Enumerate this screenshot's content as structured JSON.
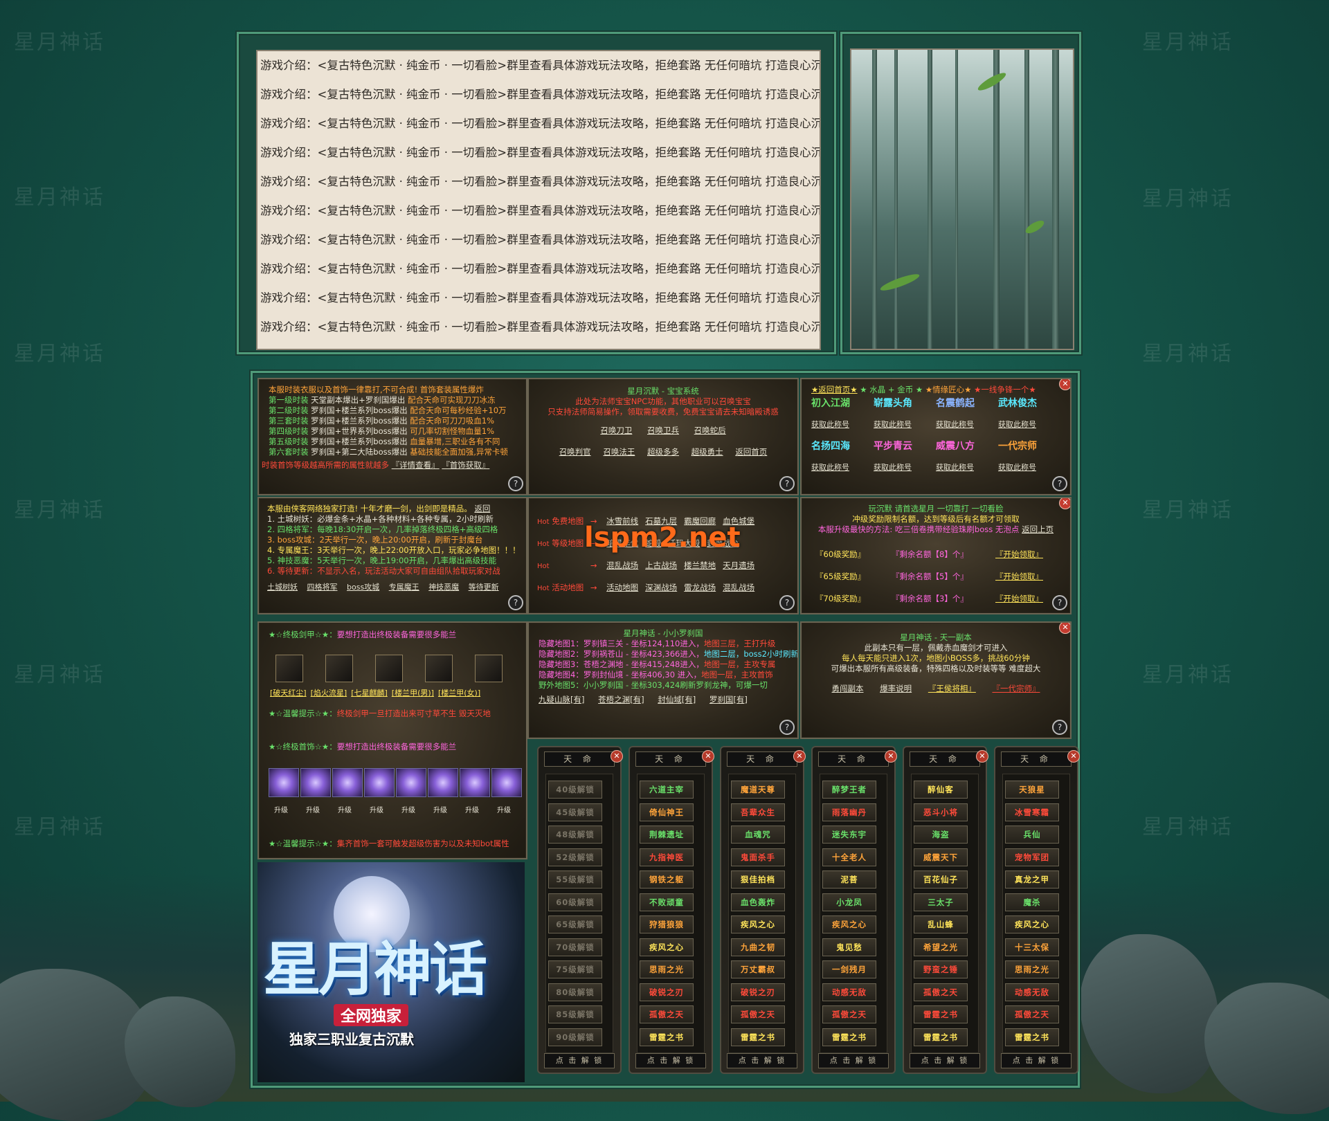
{
  "watermark": "星月神话",
  "intro_lines": [
    "游戏介绍：<复古特色沉默 · 纯金币 · 一切看脸>群里查看具体游戏玩法攻略，拒绝套路 无任何暗坑 打造良心沉默",
    "游戏介绍：<复古特色沉默 · 纯金币 · 一切看脸>群里查看具体游戏玩法攻略，拒绝套路 无任何暗坑 打造良心沉默",
    "游戏介绍：<复古特色沉默 · 纯金币 · 一切看脸>群里查看具体游戏玩法攻略，拒绝套路 无任何暗坑 打造良心沉默",
    "游戏介绍：<复古特色沉默 · 纯金币 · 一切看脸>群里查看具体游戏玩法攻略，拒绝套路 无任何暗坑 打造良心沉默",
    "游戏介绍：<复古特色沉默 · 纯金币 · 一切看脸>群里查看具体游戏玩法攻略，拒绝套路 无任何暗坑 打造良心沉默",
    "游戏介绍：<复古特色沉默 · 纯金币 · 一切看脸>群里查看具体游戏玩法攻略，拒绝套路 无任何暗坑 打造良心沉默",
    "游戏介绍：<复古特色沉默 · 纯金币 · 一切看脸>群里查看具体游戏玩法攻略，拒绝套路 无任何暗坑 打造良心沉默",
    "游戏介绍：<复古特色沉默 · 纯金币 · 一切看脸>群里查看具体游戏玩法攻略，拒绝套路 无任何暗坑 打造良心沉默",
    "游戏介绍：<复古特色沉默 · 纯金币 · 一切看脸>群里查看具体游戏玩法攻略，拒绝套路 无任何暗坑 打造良心沉默",
    "游戏介绍：<复古特色沉默 · 纯金币 · 一切看脸>群里查看具体游戏玩法攻略，拒绝套路 无任何暗坑 打造良心沉默"
  ],
  "p1": {
    "title": "本服时装衣服以及首饰一律靠打,不可合成! 首饰套装属性爆炸",
    "rows": [
      {
        "a": "第一级时装",
        "b": "天堂副本爆出+罗刹国爆出",
        "c": "配合天命可实现刀刀冰冻"
      },
      {
        "a": "第二级时装",
        "b": "罗刹国+楼兰系列boss爆出",
        "c": "配合天命可每秒经验+10万"
      },
      {
        "a": "第三套时装",
        "b": "罗刹国+楼兰系列boss爆出",
        "c": "配合天命可刀刀吸血1%"
      },
      {
        "a": "第四级时装",
        "b": "罗刹国+世界系列boss爆出",
        "c": "可几率切割怪物血量1%"
      },
      {
        "a": "第五级时装",
        "b": "罗刹国+楼兰系列boss爆出",
        "c": "血量暴增,三职业各有不同"
      },
      {
        "a": "第六套时装",
        "b": "罗刹国+第二大陆boss爆出",
        "c": "基础技能全面加强,异常卡顿"
      }
    ],
    "footer": "时装首饰等级越高所需的属性就越多",
    "link1": "『详情查看』",
    "link2": "『首饰获取』"
  },
  "p2": {
    "title": "星月沉默 - 宝宝系统",
    "line1": "此处为法师宝宝NPC功能，其他职业可以召唤宝宝",
    "line2": "只支持法师简易操作，领取需要收费，免费宝宝请去未知暗殿诱惑",
    "links_row1": [
      "召唤刀卫",
      "召唤卫兵",
      "召唤蛇后"
    ],
    "links_row2": [
      "召唤判官",
      "召唤法王",
      "超级多多",
      "超级勇士",
      "返回首页"
    ]
  },
  "p3": {
    "header": [
      "★返回首页★",
      "★ 水晶 + 金币 ★",
      "★情缘匠心★",
      "★一线争锋一个★"
    ],
    "titles1": [
      "初入江湖",
      "崭露头角",
      "名震鹤起",
      "武林俊杰"
    ],
    "titles2": [
      "名扬四海",
      "平步青云",
      "威震八方",
      "一代宗师"
    ],
    "claim": "获取此称号"
  },
  "p4": {
    "title": "本服由侠客网络独家打造! 十年才磨一剑，出剑即是精品。",
    "back": "返回",
    "lines": [
      "1. 土城树妖：必爆金条+水晶+各种材料+各种专属，2小时刷新",
      "2. 四格将军：每晚18:30开启一次，几率掉落终极四格+高级四格",
      "3. boss攻城：2天举行一次，晚上20:00开启，刷新于封魔台",
      "4. 专属魔王：3天举行一次，晚上22:00开放入口，玩家必争地图！！！",
      "5. 神技恶魔：5天举行一次，晚上19:00开启，几率爆出高级技能",
      "6. 等待更新：不显示入名，玩法活动大家可自由组队拾取玩家对战"
    ],
    "links": [
      "土城树妖",
      "四格将军",
      "boss攻城",
      "专属魔王",
      "神技恶魔",
      "等待更新"
    ]
  },
  "p5": {
    "rows": [
      {
        "tag": "Hot",
        "name": "免费地图",
        "items": [
          "冰雪前线",
          "石墓九层",
          "霸魔回廊",
          "血色城堡"
        ]
      },
      {
        "tag": "Hot",
        "name": "等级地图",
        "items": [
          "暗黑年代",
          "蛇殿",
          "沃玛大殿",
          "封魔战台"
        ]
      },
      {
        "tag": "Hot",
        "name": "",
        "items": [
          "混乱战场",
          "上古战场",
          "楼兰禁地",
          "天月遗场"
        ]
      },
      {
        "tag": "Hot",
        "name": "活动地图",
        "items": [
          "活动地图",
          "深渊战场",
          "雷龙战场",
          "混乱战场"
        ]
      }
    ],
    "arrow": "→",
    "watermark": "lspm2.net"
  },
  "p6": {
    "title": "玩沉默 请首选星月 一切靠打 一切看脸",
    "line1": "冲级奖励限制名额，达到等级后有名额才可领取",
    "line2": "本服升级最快的方法: 吃三倍卷携带经验珠刷boss 无泡点",
    "back": "返回上页",
    "rows": [
      {
        "a": "『60级奖励』",
        "b": "『剩余名额【8】个』",
        "c": "『开始领取』"
      },
      {
        "a": "『65级奖励』",
        "b": "『剩余名额【5】个』",
        "c": "『开始领取』"
      },
      {
        "a": "『70级奖励』",
        "b": "『剩余名额【3】个』",
        "c": "『开始领取』"
      }
    ]
  },
  "p7": {
    "title1": "★☆终极剑甲☆★：",
    "hint1": "要想打造出终极装备需要很多能兰",
    "equips": [
      "[破天红尘]",
      "[焰火流星]",
      "[七星麒麟]",
      "[楼兰甲(男)]",
      "[楼兰甲(女)]"
    ],
    "tip1_label": "★☆温馨提示☆★：",
    "tip1": "终极剑甲一旦打造出来可寸草不生 毁天灭地",
    "title2": "★☆终极首饰☆★：",
    "hint2": "要想打造出终极装备需要很多能兰",
    "upgrade": "升级",
    "tip2_label": "★☆温馨提示☆★：",
    "tip2": "集齐首饰一套可触发超级伤害为以及未知bot属性"
  },
  "p8": {
    "title": "星月神话 - 小小罗刹国",
    "rows": [
      {
        "a": "隐藏地图1：罗刹镇三关 - 坐标124,110进入，",
        "b": "地图三层，王打升级"
      },
      {
        "a": "隐藏地图2：罗刹祸苍山 - 坐标423,366进入，",
        "b": "地图二层，boss2小时刷新"
      },
      {
        "a": "隐藏地图3：苍梧之渊地 - 坐标415,248进入，",
        "b": "地图一层，主攻专属"
      },
      {
        "a": "隐藏地图4：罗刹封仙境 - 坐标406,30 进入，",
        "b": "地图一层，主攻首饰"
      },
      {
        "a": "野外地图5：小小罗刹国 - 坐标303,424刷新",
        "b": "罗刹龙神，可爆一切"
      }
    ],
    "links": [
      "九疑山脉[有]",
      "苍梧之渊[有]",
      "封仙域[有]",
      "罗刹国[有]"
    ]
  },
  "p9": {
    "title": "星月神话 - 天一副本",
    "line1": "此副本只有一层，佩戴赤血魔剑才可进入",
    "line2": "每人每天能只进入1次，地图小BOSS多，挑战60分钟",
    "line3": "可爆出本服所有高级装备，特殊四格以及时装等等 难度超大",
    "links": [
      "勇闯副本",
      "爆率说明",
      "『王侯将相』",
      "『一代宗师』"
    ]
  },
  "logo": {
    "main": "星月神话",
    "sub1": "全网独家",
    "sub2": "独家三职业复古沉默"
  },
  "tianming": {
    "header": "天 命",
    "footer": "点 击 解 锁",
    "close": "✕",
    "cols": [
      {
        "items": [
          "40级解锁",
          "45级解锁",
          "48级解锁",
          "52级解锁",
          "55级解锁",
          "60级解锁",
          "65级解锁",
          "70级解锁",
          "75级解锁",
          "80级解锁",
          "85级解锁",
          "90级解锁"
        ],
        "colors": [
          "lock",
          "lock",
          "lock",
          "lock",
          "lock",
          "lock",
          "lock",
          "lock",
          "lock",
          "lock",
          "lock",
          "lock"
        ]
      },
      {
        "items": [
          "六道主宰",
          "倚仙神王",
          "荆棘遗址",
          "九指神医",
          "钢铁之躯",
          "不败顽童",
          "狩猎狼狼",
          "疾风之心",
          "思雨之光",
          "破锐之刃",
          "孤傲之天",
          "雷霆之书"
        ],
        "colors": [
          "g",
          "o",
          "g",
          "r",
          "o",
          "g",
          "o",
          "y",
          "o",
          "r",
          "r",
          "y"
        ]
      },
      {
        "items": [
          "魔道天尊",
          "吾辈众生",
          "血魂咒",
          "鬼面杀手",
          "狠佳拍档",
          "血色轰炸",
          "疾风之心",
          "九曲之韧",
          "万丈霸叔",
          "破锐之刃",
          "孤傲之天",
          "雷霆之书"
        ],
        "colors": [
          "o",
          "r",
          "g",
          "r",
          "y",
          "g",
          "y",
          "o",
          "o",
          "r",
          "r",
          "y"
        ]
      },
      {
        "items": [
          "醉梦王者",
          "雨落幽丹",
          "迷失东宇",
          "十全老人",
          "泥菩",
          "小龙凤",
          "疾风之心",
          "鬼见愁",
          "一剑残月",
          "动感无敌",
          "孤傲之天",
          "雷霆之书"
        ],
        "colors": [
          "g",
          "r",
          "g",
          "o",
          "y",
          "g",
          "o",
          "y",
          "o",
          "r",
          "r",
          "y"
        ]
      },
      {
        "items": [
          "醉仙客",
          "恶斗小将",
          "海盗",
          "威震天下",
          "百花仙子",
          "三太子",
          "乱山蜂",
          "希望之光",
          "野蛮之锤",
          "孤傲之天",
          "雷霆之书",
          "雷霆之书"
        ],
        "colors": [
          "y",
          "r",
          "g",
          "o",
          "y",
          "g",
          "y",
          "o",
          "r",
          "r",
          "r",
          "y"
        ]
      },
      {
        "items": [
          "天狼星",
          "冰雪寒霜",
          "兵仙",
          "宠物军团",
          "真龙之甲",
          "魔杀",
          "疾风之心",
          "十三太保",
          "思雨之光",
          "动感无敌",
          "孤傲之天",
          "雷霆之书"
        ],
        "colors": [
          "o",
          "r",
          "g",
          "r",
          "y",
          "g",
          "y",
          "o",
          "o",
          "r",
          "r",
          "y"
        ]
      }
    ]
  }
}
